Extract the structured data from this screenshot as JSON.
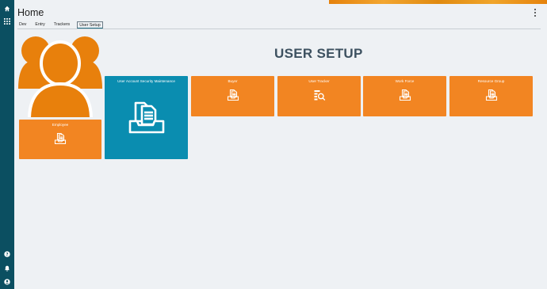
{
  "header": {
    "title": "Home"
  },
  "tabs": [
    {
      "label": "Dev"
    },
    {
      "label": "Entry"
    },
    {
      "label": "Trackers"
    },
    {
      "label": "User Setup",
      "active": true
    }
  ],
  "main": {
    "heading": "USER SETUP"
  },
  "tiles": {
    "employee": {
      "label": "Employee",
      "icon": "document-tray-icon"
    },
    "user_account": {
      "label": "User Account Security Maintenance",
      "icon": "document-tray-icon"
    },
    "buyer": {
      "label": "Buyer",
      "icon": "document-tray-icon"
    },
    "user_tracker": {
      "label": "User Tracker",
      "icon": "search-list-icon"
    },
    "work_force": {
      "label": "Work Force",
      "icon": "document-tray-icon"
    },
    "resource_group": {
      "label": "Resource Group",
      "icon": "document-tray-icon"
    }
  },
  "colors": {
    "rail": "#0b4f61",
    "tile_orange": "#f28522",
    "tile_blue": "#0a8db0",
    "people_icon": "#e8800c",
    "heading": "#3d5160"
  }
}
